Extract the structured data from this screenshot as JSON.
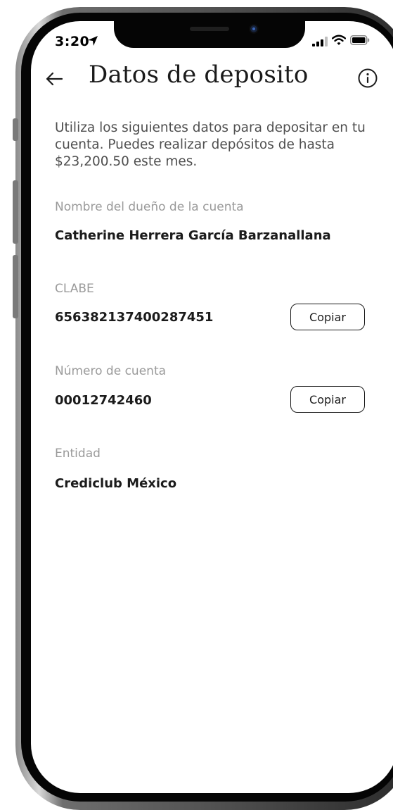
{
  "status_bar": {
    "time": "3:20"
  },
  "header": {
    "title": "Datos de deposito"
  },
  "intro_text": "Utiliza los siguientes datos para depositar en tu cuenta. Puedes realizar depósitos de hasta $23,200.50 este mes.",
  "fields": {
    "owner": {
      "label": "Nombre del dueño de la cuenta",
      "value": "Catherine Herrera García Barzanallana"
    },
    "clabe": {
      "label": "CLABE",
      "value": "656382137400287451",
      "button": "Copiar"
    },
    "account": {
      "label": "Número de cuenta",
      "value": "00012742460",
      "button": "Copiar"
    },
    "entity": {
      "label": "Entidad",
      "value": "Crediclub México"
    }
  }
}
